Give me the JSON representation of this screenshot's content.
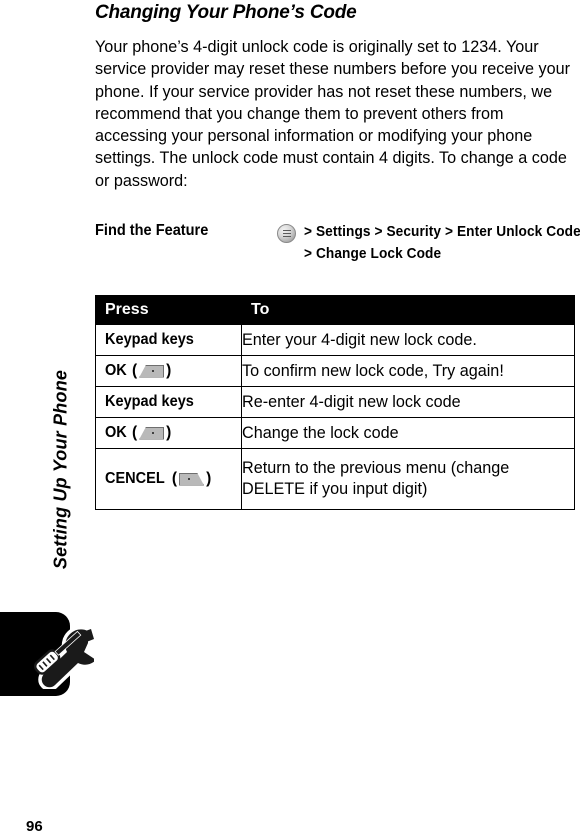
{
  "page": {
    "number": "96",
    "chapter_title": "Setting Up Your Phone",
    "tab_icon": "tools-wrench-screwdriver-icon"
  },
  "heading": "Changing Your Phone’s Code",
  "body_paragraph": "Your phone’s 4-digit unlock code is originally set to 1234. Your service provider may reset these numbers before you receive your phone. If your service provider has not reset these numbers, we recommend that you change them to prevent others from accessing your personal information or modifying your phone settings. The unlock code must contain 4 digits. To change a code or password:",
  "find_feature": {
    "label": "Find the Feature",
    "menu_icon": "menu-circle-icon",
    "path_line_1": "> Settings > Security > Enter Unlock Code",
    "path_line_2": "> Change Lock Code"
  },
  "table": {
    "headers": {
      "press": "Press",
      "to": "To"
    },
    "rows": [
      {
        "press_label": "Keypad keys",
        "press_key_icon": "",
        "to": "Enter your 4-digit new lock code."
      },
      {
        "press_label": "OK",
        "press_key_icon": "softkey-left",
        "to": "To confirm new lock code, Try again!"
      },
      {
        "press_label": "Keypad keys",
        "press_key_icon": "",
        "to": "Re-enter 4-digit new lock code"
      },
      {
        "press_label": "OK",
        "press_key_icon": "softkey-left",
        "to": "Change the lock code"
      },
      {
        "press_label": "CENCEL",
        "press_key_icon": "softkey-right",
        "to": "Return to the previous menu (change DELETE if you input digit)"
      }
    ]
  },
  "colors": {
    "header_background": "#000000",
    "header_text": "#ffffff",
    "border": "#000000",
    "softkey_fill": "#b9b9b9",
    "page_background": "#ffffff"
  }
}
